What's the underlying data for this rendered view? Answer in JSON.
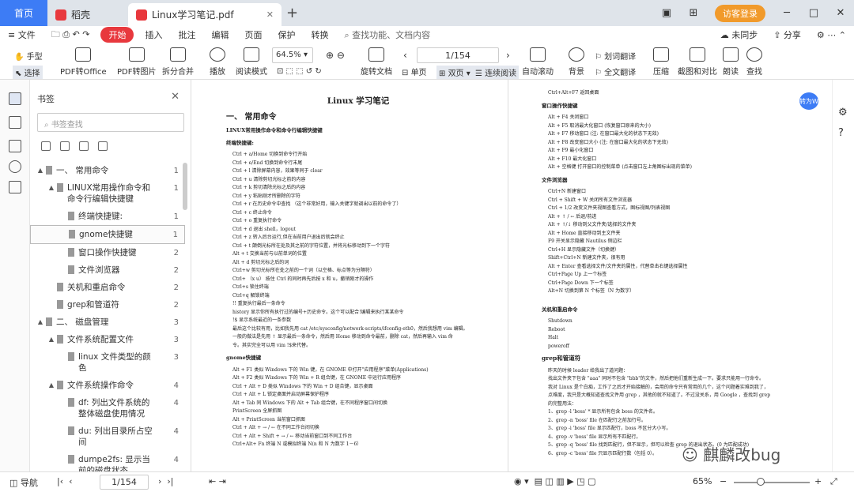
{
  "tabs": {
    "home": "首页",
    "daoke": "稻壳",
    "doc": "Linux学习笔记.pdf",
    "login": "访客登录"
  },
  "menu": {
    "file": "文件",
    "items": [
      "开始",
      "插入",
      "批注",
      "编辑",
      "页面",
      "保护",
      "转换"
    ],
    "search": "查找功能、文档内容",
    "unsync": "未同步",
    "share": "分享"
  },
  "toolbar": {
    "hand": "手型",
    "select": "选择",
    "pdf2office": "PDF转Office",
    "pdf2img": "PDF转图片",
    "split": "拆分合并",
    "play": "播放",
    "read": "阅读模式",
    "zoom": "64.5%",
    "page": "1/154",
    "rotate": "旋转文档",
    "single": "单页",
    "double": "双页",
    "continuous": "连续阅读",
    "autoscroll": "自动滚动",
    "bg": "背景",
    "translate_word": "划词翻译",
    "translate_full": "全文翻译",
    "compress": "压缩",
    "crop": "截图和对比",
    "tts": "朗读",
    "find": "查找"
  },
  "bookmark": {
    "title": "书签",
    "search": "书签查找",
    "items": [
      {
        "label": "一、 常用命令",
        "page": "1",
        "level": 0,
        "arrow": "▲"
      },
      {
        "label": "LINUX常用操作命令和命令行编辑快捷键",
        "page": "1",
        "level": 1,
        "arrow": "▲"
      },
      {
        "label": "终端快捷键:",
        "page": "1",
        "level": 2,
        "arrow": ""
      },
      {
        "label": "gnome快捷键",
        "page": "1",
        "level": 2,
        "arrow": ""
      },
      {
        "label": "窗口操作快捷键",
        "page": "2",
        "level": 2,
        "arrow": ""
      },
      {
        "label": "文件浏览器",
        "page": "2",
        "level": 2,
        "arrow": ""
      },
      {
        "label": "关机和重启命令",
        "page": "2",
        "level": 1,
        "arrow": ""
      },
      {
        "label": "grep和管道符",
        "page": "2",
        "level": 1,
        "arrow": ""
      },
      {
        "label": "二、 磁盘管理",
        "page": "3",
        "level": 0,
        "arrow": "▲"
      },
      {
        "label": "文件系统配置文件",
        "page": "3",
        "level": 1,
        "arrow": "▲"
      },
      {
        "label": "linux 文件类型的颜色",
        "page": "3",
        "level": 2,
        "arrow": ""
      },
      {
        "label": "文件系统操作命令",
        "page": "4",
        "level": 1,
        "arrow": "▲"
      },
      {
        "label": "df: 列出文件系统的整体磁盘使用情况",
        "page": "4",
        "level": 2,
        "arrow": ""
      },
      {
        "label": "du: 列出目录所占空间",
        "page": "4",
        "level": 2,
        "arrow": ""
      },
      {
        "label": "dumpe2fs: 显示当前的磁盘状态",
        "page": "4",
        "level": 2,
        "arrow": ""
      }
    ]
  },
  "page1": {
    "title": "Linux 学习笔记",
    "h1": "一、 常用命令",
    "h2a": "LINUX常用操作命令和命令行编辑快捷键",
    "h2b": "终端快捷键:",
    "lines": [
      "Ctrl + a/Home 切换到命令行开始",
      "Ctrl + e/End 切换到命令行末尾",
      "Ctrl + l 清除屏幕内容，效果等同于 clear",
      "Ctrl + u 清除剪切光标之前的内容",
      "Ctrl + k 剪切清除光标之后的内容",
      "Ctrl + y 粘贴刚才所删除的字符",
      "Ctrl + r 在历史命令中查找 （这个非常好用，输入关键字就调出以前的命令了）",
      "Ctrl + c 终止命令",
      "Ctrl + o 重复执行命令",
      "Ctrl + d 退出 shell，logout",
      "Ctrl + z 转入后台运行,但在当前用户退出后就会终止",
      "Ctrl + t 颠倒光标所在处及其之前的字符位置，并将光标移动到下一个字符",
      "Alt + t 交换当前与以前单词的位置",
      "Alt + d 剪切光标之后的词",
      "Ctrl+w 剪切光标所在处之前的一个词（以空格、标点等为分隔符）",
      "Ctrl+ （x u） 按住 Ctrl 的同时再先后按 x 和 u，撤销刚才的操作",
      "Ctrl+s 锁住终端",
      "Ctrl+q 解锁终端",
      "!! 重复执行最后一条命令",
      "history 显示你所有执行过的编号+历史命令。这个可以配合!编辑来执行某某命令",
      "!$ 显示系统最近的一条参数",
      "最后这个比较有用，比如我先用 cat /etc/sysconfig/network-scripts/ifconfig-eth0，然后我想用 vim 编辑。",
      "一般的做法是先用 ↑ 显示最后一条命令，然后用 Home 移动到命令最前，删除 cat，然后再输入 vim 命",
      "令。其实完全可以用 vim !$来代替。"
    ],
    "h2c": "gnome快捷键",
    "lines2": [
      "Alt + F1 类似 Windows 下的 Win 键，在 GNOME 中打开\"应用程序\"菜单(Applications)",
      "Alt + F2 类似 Windows 下的 Win + R 组合键，在 GNOME 中运行应用程序",
      "Ctrl + Alt + D 类似 Windows 下的 Win + D 组合键，显示桌面",
      "Ctrl + Alt + L 锁定桌面并启动屏幕保护程序",
      "Alt + Tab 同 Windows 下的 Alt + Tab 组合键，在不同程序窗口间切换",
      "PrintScreen 全屏抓图",
      "Alt + PrintScreen 当前窗口抓图",
      "Ctrl + Alt + → / ← 在不同工作台间切换",
      "Ctrl + Alt + Shift + → / ← 移动当前窗口到不同工作台",
      "Ctrl+Alt+ Fn 终端 N 或模拟终端 N(n 和 N 为数字 1－6）"
    ]
  },
  "page2": {
    "top": "Ctrl+Alt+F7 返回桌面",
    "h2a": "窗口操作快捷键",
    "linesA": [
      "Alt + F4 关闭窗口",
      "Alt + F5 取消最大化窗口 (恢复窗口原来的大小)",
      "Alt + F7 移动窗口 (注: 在窗口最大化的状态下无效)",
      "Alt + F8 改变窗口大小 (注: 在窗口最大化的状态下无效)",
      "Alt + F9 最小化窗口",
      "Alt + F10 最大化窗口",
      "Alt + 空格键 打开窗口的控制菜单 (点击窗口左上角图标出现的菜单)"
    ],
    "h2b": "文件浏览器",
    "linesB": [
      "Ctrl+N 新建窗口",
      "Ctrl + Shift + W 关闭所有文件浏览器",
      "Ctrl + 1/2 改变文件夹视图查看方式，图标视图/列表视图",
      "Alt + ↑ / ← 后退/前进",
      "Alt + ↑/↓ 移动到父文件夹/选择的文件夹",
      "Alt + Home 直接移动到主文件夹",
      "F9 开关显示隐藏 Nautilus 侧边栏",
      "Ctrl+H 显示隐藏文件（切换键）",
      "Shift+Ctrl+N 新建文件夹，很有用",
      "Alt + Enter 查看选择文件/文件夹的属性，代替单击右键选择属性",
      "Ctrl+Page Up 上一个标签",
      "Ctrl+Page Down 下一个标签",
      "Alt+N 切换到第 N 个标签（N 为数字）"
    ],
    "h2c": "关机和重启命令",
    "linesC": [
      "Shutdown",
      "Reboot",
      "Halt",
      "poweroff"
    ],
    "h2d": "grep和管道符",
    "linesD": [
      "昨天的时候 leader 给我出了道问题：",
      "找出文件夹下包含 \"aaa\" 同时不包含 \"bbb\"的文件，然后把他们重新生成一下。要求只能用一行命令。",
      "我对 Linux 是个白痴，工作了之后才开始接触的，会用的命令只有常用的几个，这个问题着实难到我了，",
      "点难度，我只是大概知道查找文件用 grep ，其他的就不知道了。不过没关系，用 Google ，查找到 grep",
      "的完整用法：",
      "1、grep -l 'boss' * 显示所有包含 boss 的文件名。",
      "2、grep -n 'boss' file 在匹配行之前加行号。",
      "3、grep -i 'boss' file 显示匹配行，boss 不区分大小写。",
      "4、grep -v 'boss' file 显示所有不匹配行。",
      "5、grep -q 'boss' file 找到匹配行，但不显示，但可以检查 grep 的退出状态。(0 为匹配成功)",
      "6、grep -c 'boss' file 只显示匹配行数（包括 0）。"
    ],
    "bubble": "转为W"
  },
  "watermark": "麒麟改bug",
  "status": {
    "nav": "导航",
    "page": "1/154",
    "zoom": "65%"
  }
}
